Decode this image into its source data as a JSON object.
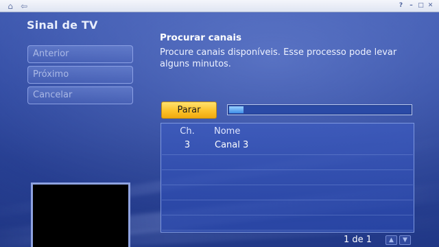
{
  "window": {
    "home_icon": "home-icon",
    "back_icon": "back-arrow-icon",
    "help_label": "?",
    "controls": [
      "minimize-icon",
      "maximize-icon",
      "close-icon"
    ]
  },
  "page": {
    "title": "Sinal de TV"
  },
  "sidebar": {
    "items": [
      {
        "label": "Anterior"
      },
      {
        "label": "Próximo"
      },
      {
        "label": "Cancelar"
      }
    ]
  },
  "main": {
    "section_title": "Procurar canais",
    "description": "Procure canais disponíveis. Esse processo pode levar alguns minutos.",
    "stop_label": "Parar",
    "progress": 0.08
  },
  "table": {
    "headers": {
      "channel": "Ch.",
      "name": "Nome"
    },
    "rows": [
      {
        "channel": "3",
        "name": "Canal 3"
      }
    ]
  },
  "pager": {
    "text": "1 de 1"
  },
  "colors": {
    "background": "#2c469e",
    "accent_button": "#fcc22a",
    "progress_fill": "#3f8fe8"
  }
}
